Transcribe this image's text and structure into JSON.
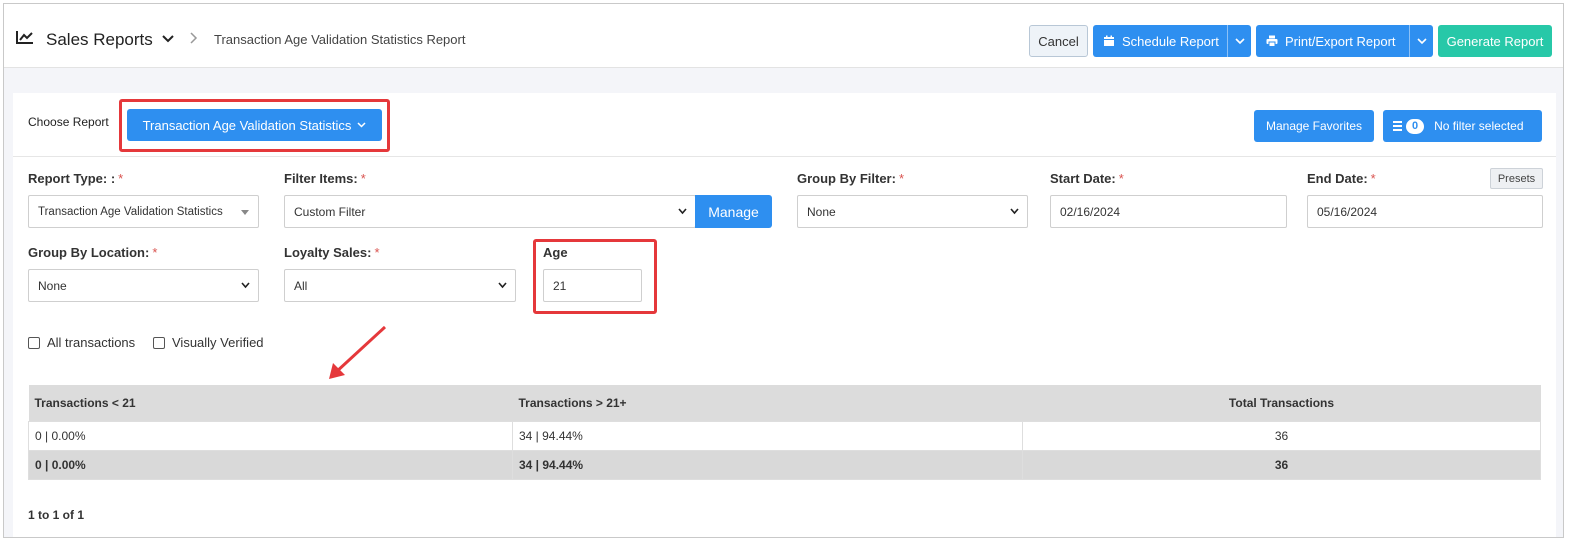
{
  "header": {
    "title": "Sales Reports",
    "breadcrumb": "Transaction Age Validation Statistics Report",
    "cancel_label": "Cancel",
    "schedule_label": "Schedule Report",
    "print_label": "Print/Export Report",
    "generate_label": "Generate Report",
    "icons": [
      "line-chart-icon",
      "chevron-down-icon",
      "chevron-right-icon",
      "calendar-icon",
      "printer-icon"
    ]
  },
  "choose": {
    "label": "Choose Report",
    "selected_report": "Transaction Age Validation Statistics",
    "favorites_label": "Manage Favorites",
    "filter_count": "0",
    "filter_label": "No filter selected"
  },
  "form": {
    "report_type": {
      "label": "Report Type: :",
      "value": "Transaction Age Validation Statistics"
    },
    "filter_items": {
      "label": "Filter Items:",
      "value": "Custom Filter",
      "manage_label": "Manage"
    },
    "group_by_filter": {
      "label": "Group By Filter:",
      "value": "None"
    },
    "start_date": {
      "label": "Start Date:",
      "value": "02/16/2024"
    },
    "end_date": {
      "label": "End Date:",
      "value": "05/16/2024"
    },
    "presets_label": "Presets",
    "group_by_location": {
      "label": "Group By Location:",
      "value": "None"
    },
    "loyalty_sales": {
      "label": "Loyalty Sales:",
      "value": "All"
    },
    "age": {
      "label": "Age",
      "value": "21"
    },
    "required_mark": "*"
  },
  "options": {
    "all_transactions": "All transactions",
    "visually_verified": "Visually Verified"
  },
  "table": {
    "headers": [
      "Transactions < 21",
      "Transactions > 21+",
      "Total Transactions"
    ],
    "rows": [
      [
        "0 | 0.00%",
        "34 | 94.44%",
        "36"
      ]
    ],
    "total": [
      "0 | 0.00%",
      "34 | 94.44%",
      "36"
    ]
  },
  "pager": "1 to 1 of 1",
  "colors": {
    "primary": "#2e8ff0",
    "generate": "#27c8a8",
    "highlight": "#e5383b",
    "required": "#d9534f"
  }
}
